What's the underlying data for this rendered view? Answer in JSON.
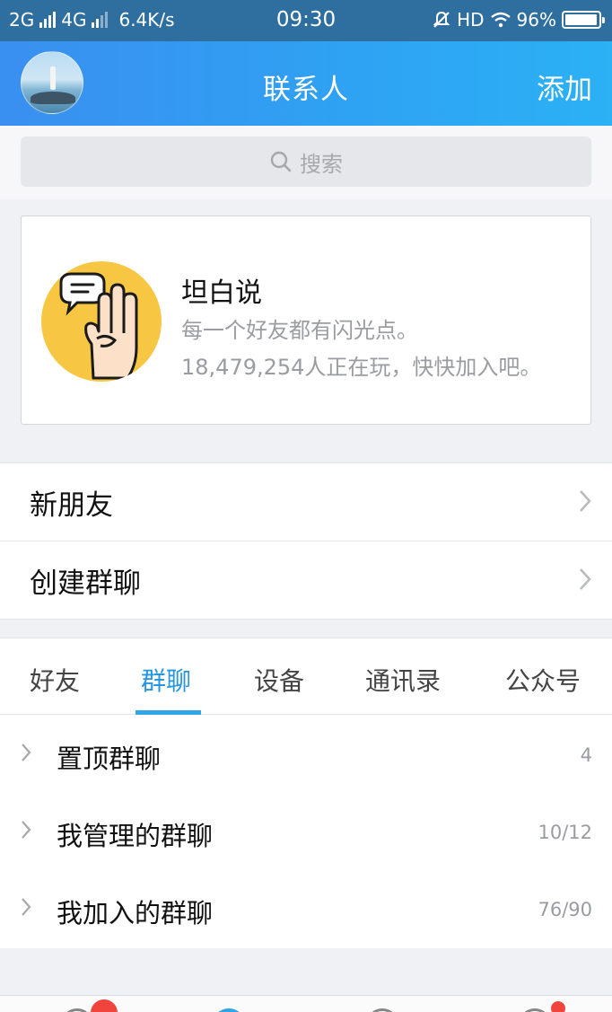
{
  "status_bar": {
    "network1": "2G",
    "network2": "4G",
    "speed": "6.4K/s",
    "time": "09:30",
    "hd": "HD",
    "battery": "96%",
    "battery_level": 0.96
  },
  "header": {
    "title": "联系人",
    "add_label": "添加"
  },
  "search": {
    "placeholder": "搜索"
  },
  "promo_card": {
    "title": "坦白说",
    "subtitle": "每一个好友都有闪光点。",
    "count_text": "18,479,254人正在玩，快快加入吧。"
  },
  "menu": {
    "new_friends": "新朋友",
    "create_group": "创建群聊"
  },
  "tabs": [
    {
      "label": "好友",
      "active": false
    },
    {
      "label": "群聊",
      "active": true
    },
    {
      "label": "设备",
      "active": false
    },
    {
      "label": "通讯录",
      "active": false
    },
    {
      "label": "公众号",
      "active": false
    }
  ],
  "groups": [
    {
      "label": "置顶群聊",
      "count": "4"
    },
    {
      "label": "我管理的群聊",
      "count": "10/12"
    },
    {
      "label": "我加入的群聊",
      "count": "76/90"
    }
  ],
  "colors": {
    "accent": "#2796e0",
    "header_gradient_start": "#3a8ff0",
    "header_gradient_end": "#2cb1f5",
    "badge": "#f0443c"
  }
}
